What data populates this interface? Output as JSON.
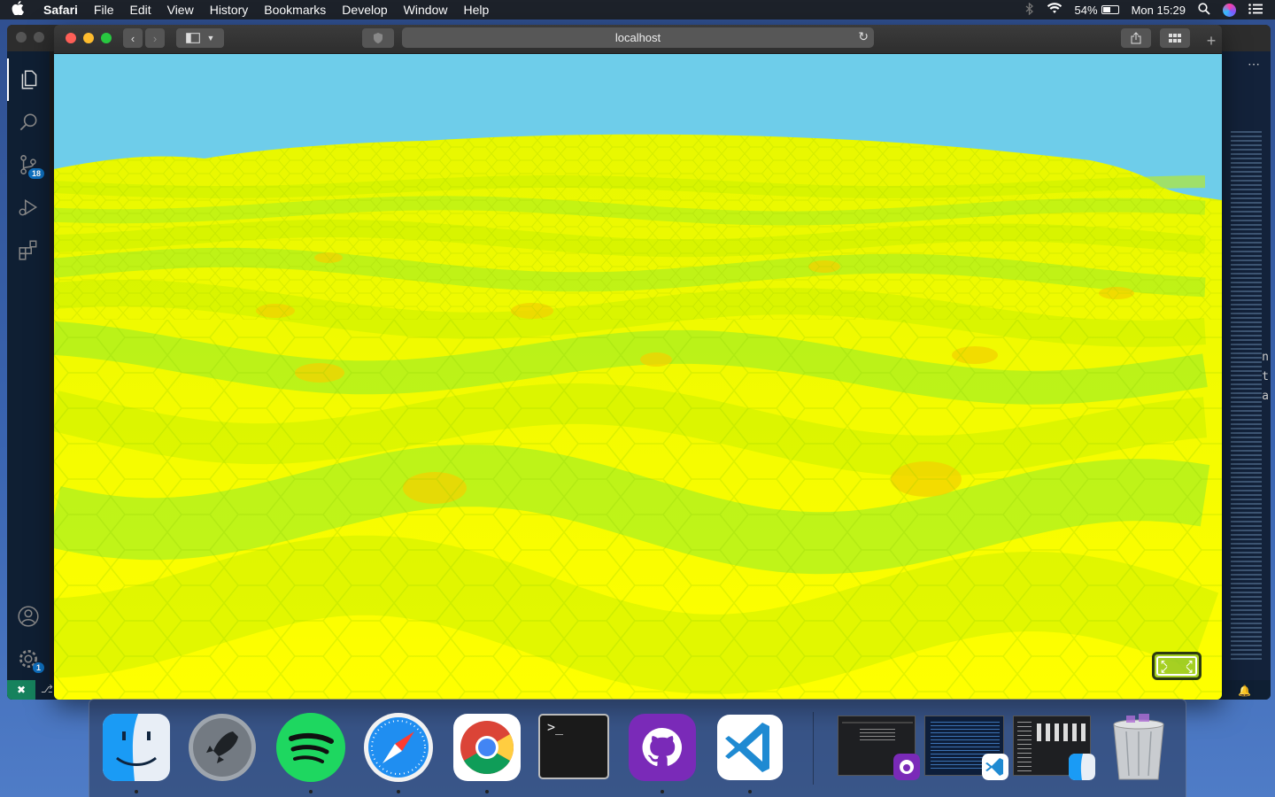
{
  "menubar": {
    "apple_icon": "apple-logo",
    "app_name": "Safari",
    "menus": [
      "File",
      "Edit",
      "View",
      "History",
      "Bookmarks",
      "Develop",
      "Window",
      "Help"
    ],
    "battery_percent": "54%",
    "battery_level": 0.54,
    "clock": "Mon 15:29"
  },
  "vscode": {
    "activity_icons": [
      "explorer-icon",
      "search-icon",
      "source-control-icon",
      "run-debug-icon",
      "extensions-icon"
    ],
    "source_control_badge": "18",
    "settings_badge": "1",
    "side_glyphs": "n\nt\na"
  },
  "safari": {
    "address": "localhost",
    "colors": {
      "sky": "#6ecdea",
      "terrain_high": "#ffff00",
      "terrain_mid": "#c8f000",
      "terrain_low": "#7be836",
      "terrain_peak": "#f2d200"
    }
  },
  "dock": {
    "apps": [
      {
        "name": "Finder",
        "icon": "finder-icon",
        "running": true
      },
      {
        "name": "Launchpad",
        "icon": "launchpad-icon",
        "running": false
      },
      {
        "name": "Spotify",
        "icon": "spotify-icon",
        "running": true
      },
      {
        "name": "Safari",
        "icon": "safari-icon",
        "running": true
      },
      {
        "name": "Chrome",
        "icon": "chrome-icon",
        "running": true
      },
      {
        "name": "Terminal",
        "icon": "terminal-icon",
        "running": false
      },
      {
        "name": "GitHub Desktop",
        "icon": "github-icon",
        "running": true
      },
      {
        "name": "Visual Studio Code",
        "icon": "vscode-icon",
        "running": true
      }
    ],
    "terminal_prompt": ">_",
    "minimized": [
      "github-window-thumbnail",
      "vscode-window-thumbnail",
      "finder-window-thumbnail"
    ]
  }
}
